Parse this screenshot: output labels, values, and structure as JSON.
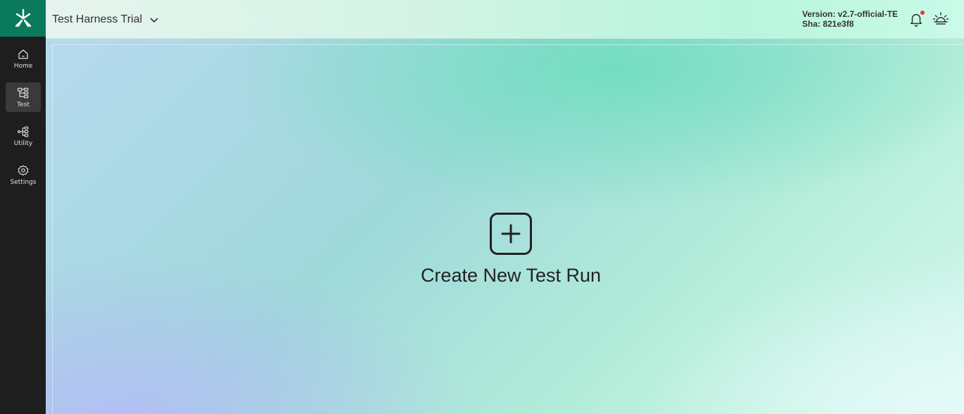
{
  "header": {
    "project_title": "Test Harness Trial",
    "version_line": "Version: v2.7-official-TE",
    "sha_line": "Sha: 821e3f8"
  },
  "sidebar": {
    "items": [
      {
        "label": "Home",
        "icon": "home-icon",
        "active": false
      },
      {
        "label": "Test",
        "icon": "tree-icon",
        "active": true
      },
      {
        "label": "Utility",
        "icon": "hierarchy-icon",
        "active": false
      },
      {
        "label": "Settings",
        "icon": "gear-icon",
        "active": false
      }
    ]
  },
  "main": {
    "create_label": "Create New Test Run"
  },
  "colors": {
    "sidebar_bg": "#1e1e1e",
    "logo_bg": "#0b7a5c",
    "notification_dot": "#e53935"
  }
}
